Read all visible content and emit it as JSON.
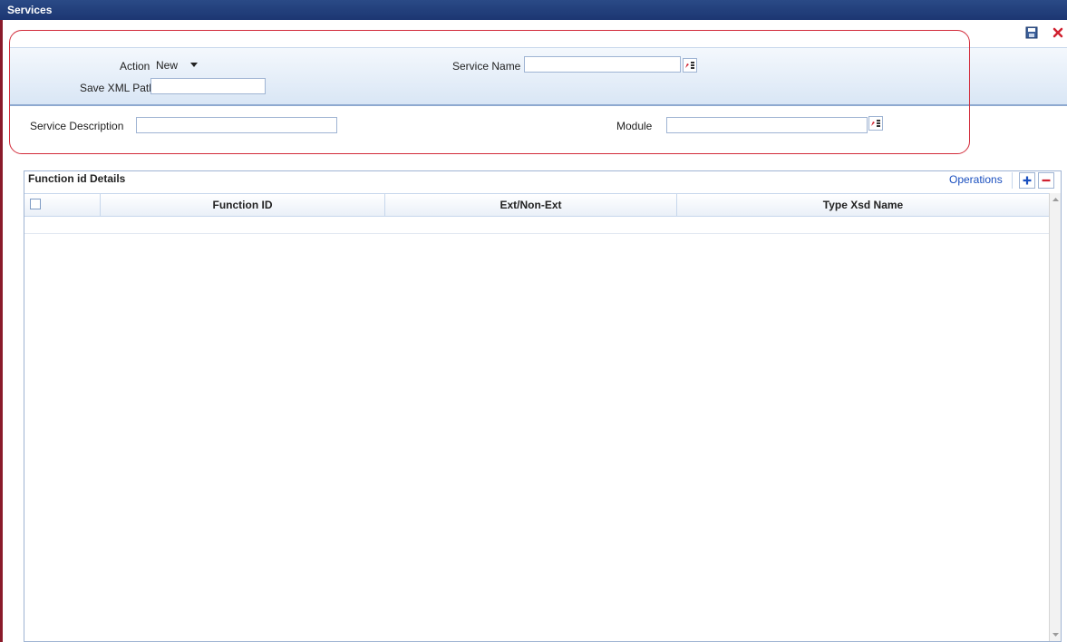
{
  "window": {
    "title": "Services"
  },
  "toolbar": {
    "save_icon": "save-icon",
    "close_icon": "close-icon"
  },
  "form": {
    "action_label": "Action",
    "action_value": "New",
    "save_xml_path_label": "Save XML Path",
    "save_xml_path_value": "",
    "service_name_label": "Service Name",
    "service_name_value": "",
    "service_description_label": "Service Description",
    "service_description_value": "",
    "module_label": "Module",
    "module_value": ""
  },
  "grid": {
    "title": "Function id Details",
    "operations_label": "Operations",
    "columns": [
      "Function ID",
      "Ext/Non-Ext",
      "Type Xsd Name"
    ],
    "rows": []
  },
  "colors": {
    "titlebar": "#1c3672",
    "accent_red": "#d22b3a",
    "link": "#1a4fbf"
  }
}
